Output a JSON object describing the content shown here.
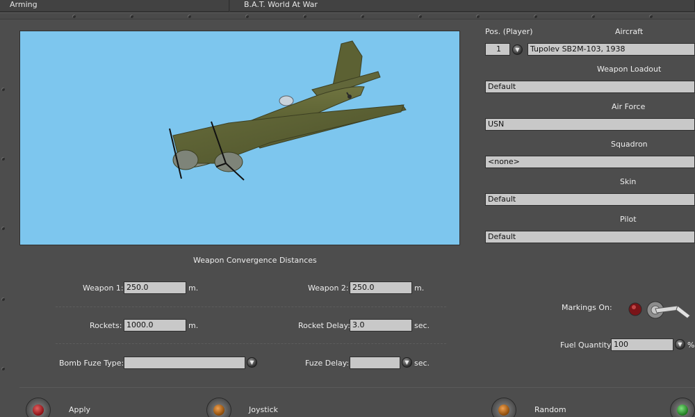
{
  "tabs": {
    "arming": "Arming",
    "title": "B.A.T. World At War"
  },
  "aircraft_panel": {
    "pos_label": "Pos. (Player)",
    "pos_value": "1",
    "aircraft_label": "Aircraft",
    "aircraft_value": "Tupolev SB2M-103, 1938",
    "loadout_label": "Weapon Loadout",
    "loadout_value": "Default",
    "airforce_label": "Air Force",
    "airforce_value": "USN",
    "squadron_label": "Squadron",
    "squadron_value": "<none>",
    "skin_label": "Skin",
    "skin_value": "Default",
    "pilot_label": "Pilot",
    "pilot_value": "Default"
  },
  "convergence": {
    "title": "Weapon Convergence Distances",
    "weapon1_label": "Weapon 1:",
    "weapon1_value": "250.0",
    "weapon1_unit": "m.",
    "weapon2_label": "Weapon 2:",
    "weapon2_value": "250.0",
    "weapon2_unit": "m.",
    "rockets_label": "Rockets:",
    "rockets_value": "1000.0",
    "rockets_unit": "m.",
    "rocket_delay_label": "Rocket Delay:",
    "rocket_delay_value": "3.0",
    "rocket_delay_unit": "sec.",
    "bomb_fuze_label": "Bomb Fuze Type:",
    "bomb_fuze_value": "",
    "fuze_delay_label": "Fuze Delay:",
    "fuze_delay_value": "",
    "fuze_delay_unit": "sec."
  },
  "options": {
    "markings_label": "Markings On:",
    "fuel_label": "Fuel Quantity:",
    "fuel_value": "100",
    "fuel_unit": "%"
  },
  "buttons": {
    "apply": "Apply",
    "joystick": "Joystick",
    "random": "Random"
  },
  "dropdown_glyph": "▼",
  "colors": {
    "sky": "#7dc6ee",
    "panel": "#4d4d4d",
    "field": "#c8c8c8",
    "lamp_red": "#b0141a",
    "lamp_amber": "#c06a10",
    "lamp_green": "#2aa12a"
  }
}
